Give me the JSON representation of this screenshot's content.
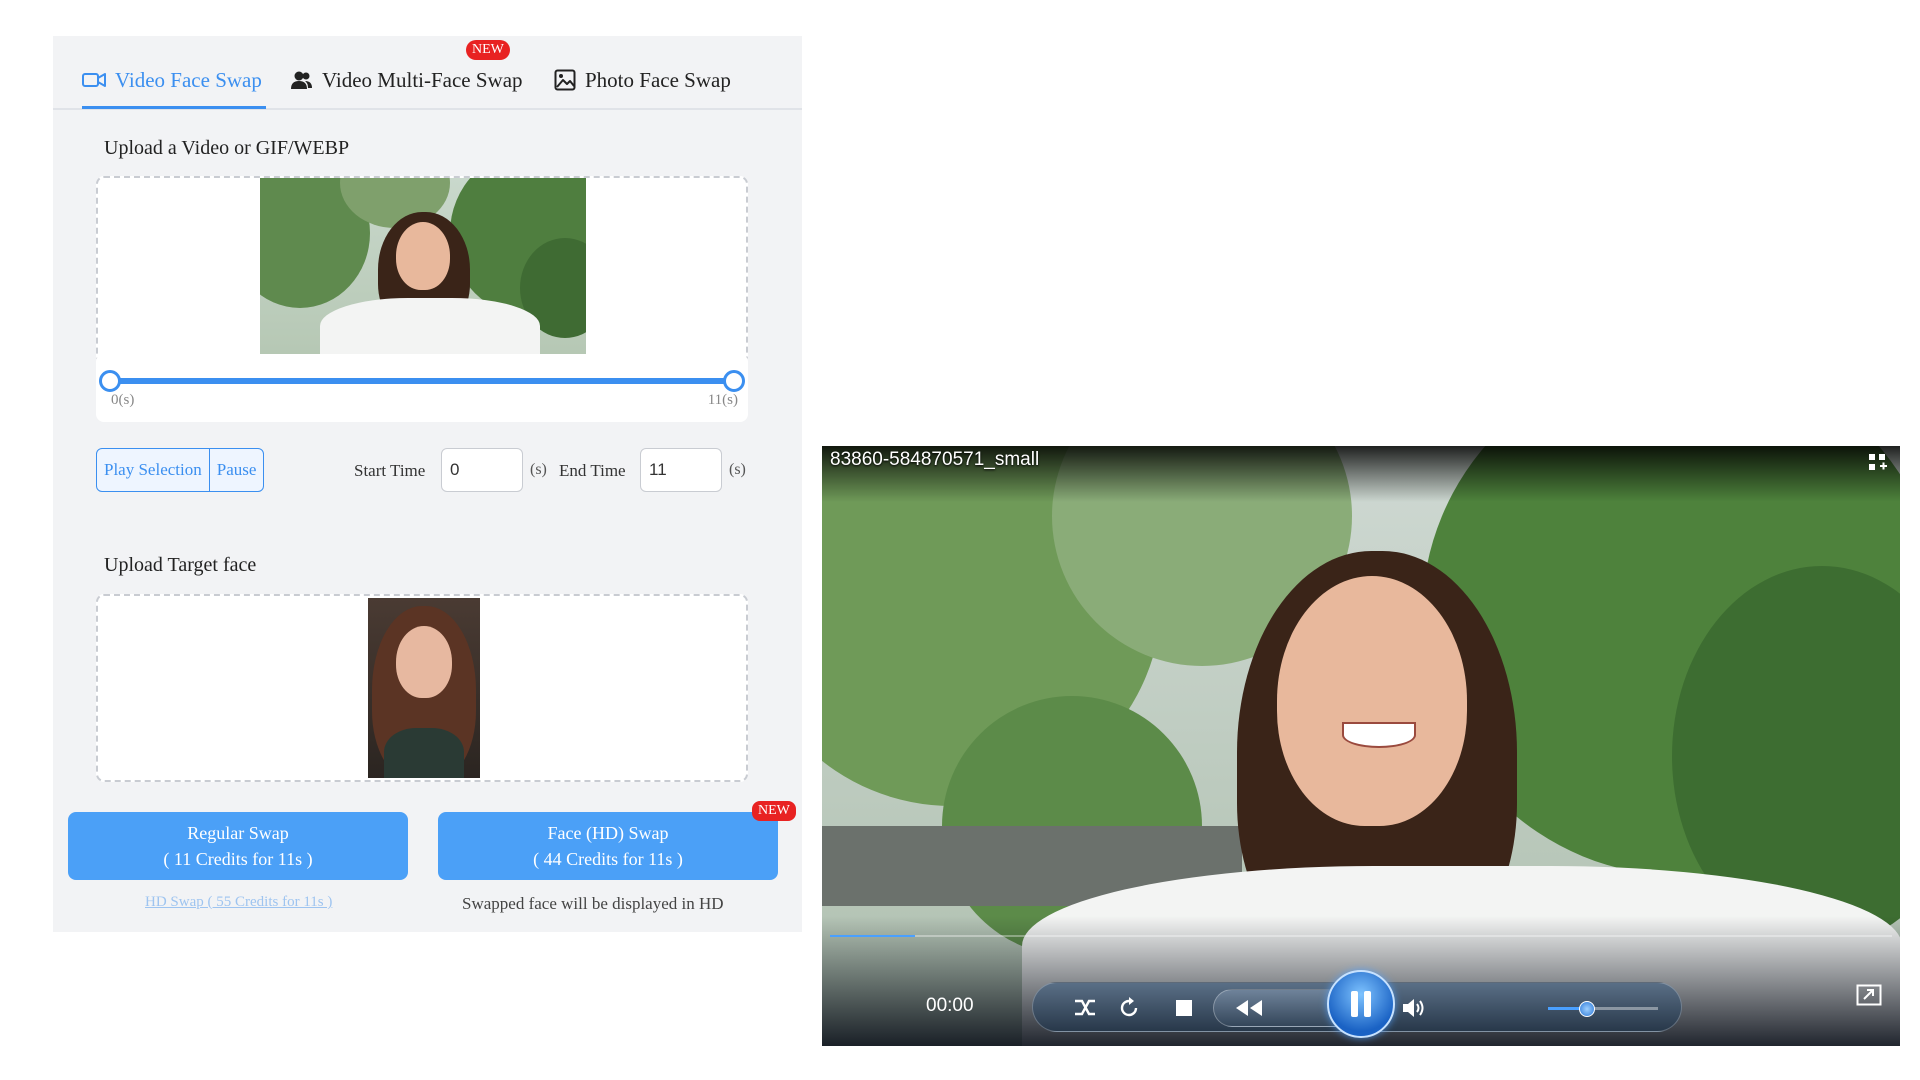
{
  "tabs": [
    {
      "label": "Video Face Swap",
      "icon": "video-camera-icon",
      "active": true
    },
    {
      "label": "Video Multi-Face Swap",
      "icon": "users-icon",
      "badge": "NEW"
    },
    {
      "label": "Photo Face Swap",
      "icon": "image-icon"
    }
  ],
  "upload_video": {
    "label": "Upload a Video or GIF/WEBP"
  },
  "range_slider": {
    "min_label": "0(s)",
    "max_label": "11(s)",
    "start_fraction": 0,
    "end_fraction": 1
  },
  "controls": {
    "play_selection": "Play Selection",
    "pause": "Pause",
    "start_time_label": "Start Time",
    "start_time_value": "0",
    "end_time_label": "End Time",
    "end_time_value": "11",
    "unit": "(s)"
  },
  "upload_face": {
    "label": "Upload Target face"
  },
  "swap": {
    "regular_title": "Regular Swap",
    "regular_credits": "( 11 Credits for 11s )",
    "hd_title": "Face (HD) Swap",
    "hd_credits": "( 44 Credits for 11s )",
    "hd_badge": "NEW",
    "hd_link": "HD Swap ( 55 Credits for 11s )",
    "hd_note": "Swapped face will be displayed in HD"
  },
  "player": {
    "title": "83860-584870571_small",
    "time": "00:00",
    "progress_fraction": 0.08,
    "volume_fraction": 0.35
  },
  "colors": {
    "accent": "#3b8ff0",
    "button": "#4ba0f7",
    "badge": "#e82222"
  }
}
